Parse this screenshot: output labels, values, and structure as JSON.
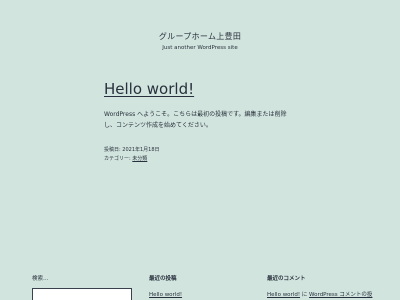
{
  "header": {
    "site_title": "グループホーム上豊田",
    "tagline": "Just another WordPress site"
  },
  "post": {
    "title": "Hello world!",
    "content": "WordPress へようこそ。こちらは最初の投稿です。編集または削除し、コンテンツ作成を始めてください。",
    "meta": {
      "date_label": "投稿日:",
      "date_value": "2021年1月18日",
      "category_label": "カテゴリー:",
      "category_value": "未分類"
    }
  },
  "footer": {
    "search": {
      "label": "検索…",
      "value": "",
      "placeholder": ""
    },
    "recent_posts": {
      "heading": "最近の投稿",
      "items": [
        "Hello world!"
      ]
    },
    "recent_comments": {
      "heading": "最近のコメント",
      "post_link": "Hello world!",
      "connector": " に ",
      "author_link": "WordPress コメントの投"
    }
  },
  "colors": {
    "background": "#d1e4dd",
    "text": "#28303d",
    "input_border": "#39414d"
  }
}
